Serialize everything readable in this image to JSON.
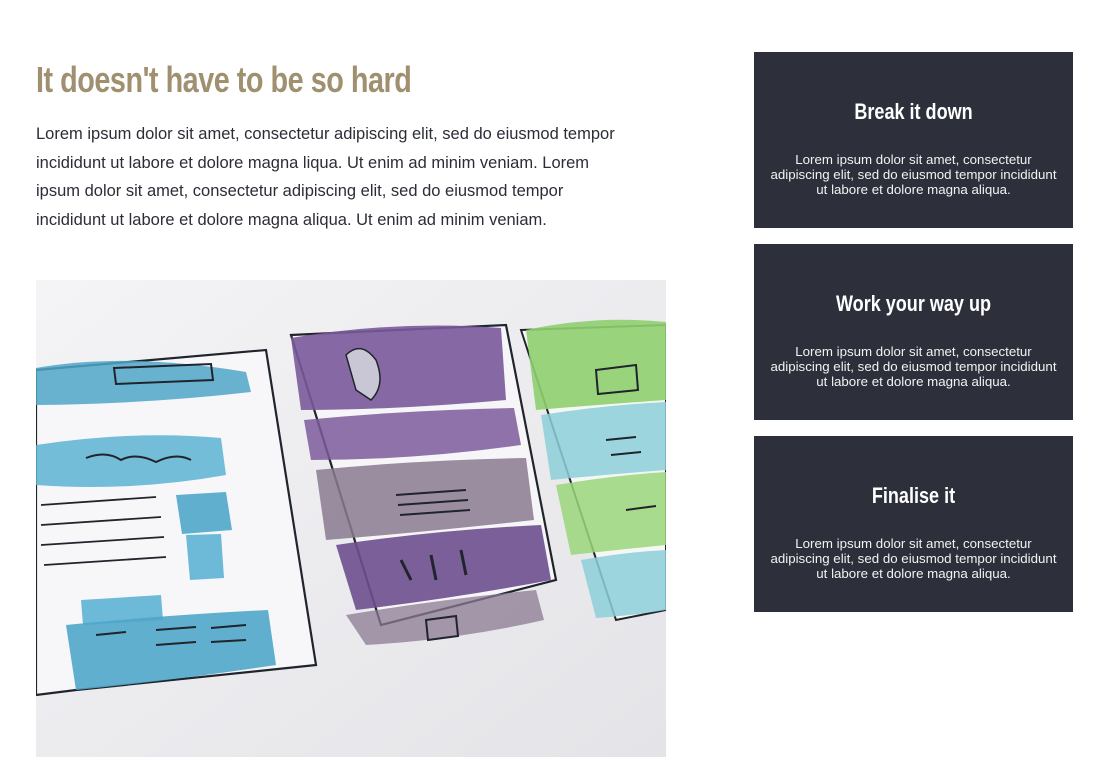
{
  "main": {
    "title": "It doesn't have to be so hard",
    "paragraph": "Lorem ipsum dolor sit amet, consectetur adipiscing elit, sed do eiusmod tempor incididunt ut labore et dolore magna liqua. Ut enim ad minim veniam. Lorem ipsum dolor sit amet, consectetur adipiscing elit, sed do eiusmod tempor incididunt ut labore et dolore magna aliqua. Ut enim ad minim veniam."
  },
  "sidebar": {
    "cards": [
      {
        "title": "Break it down",
        "text": "Lorem ipsum dolor sit amet, consectetur adipiscing elit, sed do eiusmod tempor incididunt ut labore et dolore magna aliqua."
      },
      {
        "title": "Work your way up",
        "text": "Lorem ipsum dolor sit amet, consectetur adipiscing elit, sed do eiusmod tempor incididunt ut labore et dolore magna aliqua."
      },
      {
        "title": "Finalise it",
        "text": "Lorem ipsum dolor sit amet, consectetur adipiscing elit, sed do eiusmod tempor incididunt ut labore et dolore magna aliqua."
      }
    ]
  },
  "colors": {
    "title": "#a09070",
    "card_background": "#2d303b",
    "body_text": "#2b2d37"
  }
}
